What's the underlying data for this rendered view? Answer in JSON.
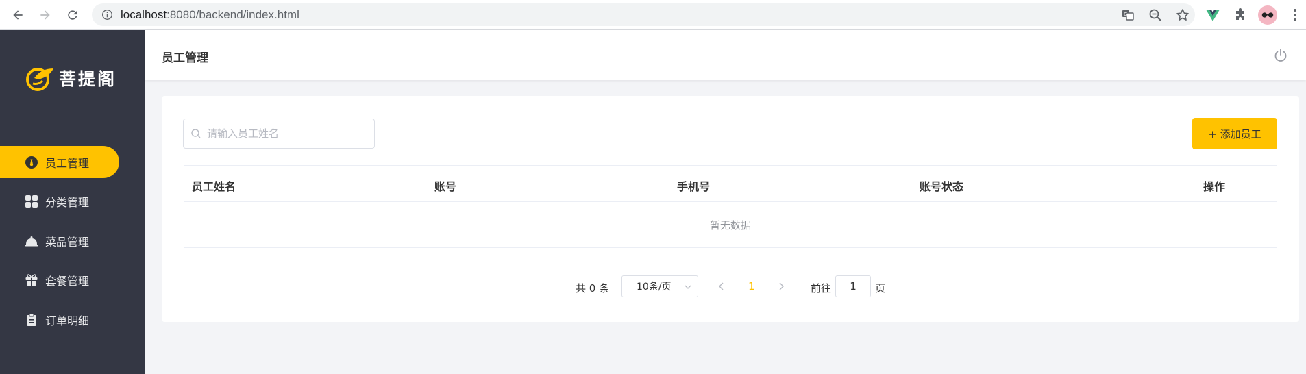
{
  "browser": {
    "url_host": "localhost",
    "url_rest": ":8080/backend/index.html"
  },
  "sidebar": {
    "logo_text": "菩提阁",
    "items": [
      {
        "label": "员工管理",
        "icon": "employee-icon",
        "active": true
      },
      {
        "label": "分类管理",
        "icon": "category-icon",
        "active": false
      },
      {
        "label": "菜品管理",
        "icon": "dish-icon",
        "active": false
      },
      {
        "label": "套餐管理",
        "icon": "gift-icon",
        "active": false
      },
      {
        "label": "订单明细",
        "icon": "clipboard-icon",
        "active": false
      }
    ]
  },
  "header": {
    "title": "员工管理"
  },
  "toolbar": {
    "search_placeholder": "请输入员工姓名",
    "search_value": "",
    "add_label": "+ 添加员工"
  },
  "table": {
    "columns": [
      "员工姓名",
      "账号",
      "手机号",
      "账号状态",
      "操作"
    ],
    "rows": [],
    "empty_text": "暂无数据"
  },
  "pagination": {
    "total_text": "共 0 条",
    "page_size": "10条/页",
    "current_page": "1",
    "goto_label": "前往",
    "goto_value": "1",
    "goto_suffix": "页"
  },
  "colors": {
    "accent": "#ffc200",
    "sidebar_bg": "#343744"
  }
}
